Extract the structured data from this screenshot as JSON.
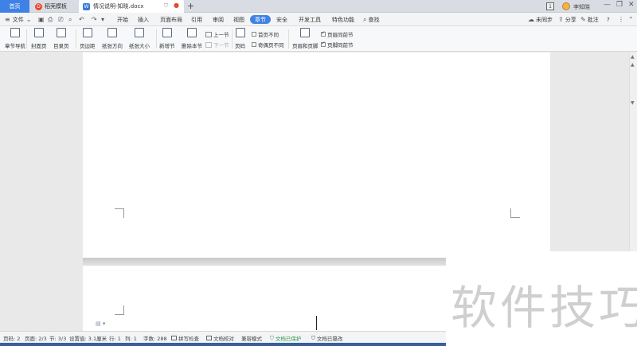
{
  "tabs": {
    "home": "首页",
    "template": "稻壳模板",
    "template_badge": "D",
    "document": "情况说明-知晓.docx",
    "document_badge": "W",
    "add": "+"
  },
  "titlebar": {
    "user": "李知晓",
    "count_box": "1",
    "min": "—",
    "restore": "❐",
    "close": "✕"
  },
  "menubar": {
    "file": "文件",
    "items": [
      "开始",
      "插入",
      "页面布局",
      "引用",
      "审阅",
      "视图",
      "章节",
      "安全",
      "开发工具",
      "特色功能"
    ],
    "active": "章节",
    "search": "查找",
    "sync": "未同步",
    "share": "分享",
    "comment": "批注",
    "help": "?"
  },
  "ribbon": {
    "nav": "章节导航",
    "cover": "封面页",
    "toc": "目录页",
    "margin": "页边距",
    "orientation": "纸张方向",
    "size": "纸张大小",
    "new_section": "新增节",
    "delete_section": "删除本节",
    "prev_section": "上一节",
    "next_section": "下一节",
    "page_number": "页码",
    "first_page_diff": "首页不同",
    "odd_even_diff": "奇偶页不同",
    "header_footer": "页眉和页脚",
    "header_same": "页眉同前节",
    "footer_same": "页脚同前节"
  },
  "watermark": "软件技巧",
  "status": {
    "page_num": "页码: 2",
    "pages": "页面: 2/3",
    "section": "节: 3/3",
    "setting": "设置值: 3.1厘米",
    "row": "行: 1",
    "col": "列: 1",
    "words": "字数: 288",
    "spell": "拼写检查",
    "proof": "文档校对",
    "compat": "兼容模式",
    "protected": "文档已保护",
    "modified": "文档已篡改"
  }
}
